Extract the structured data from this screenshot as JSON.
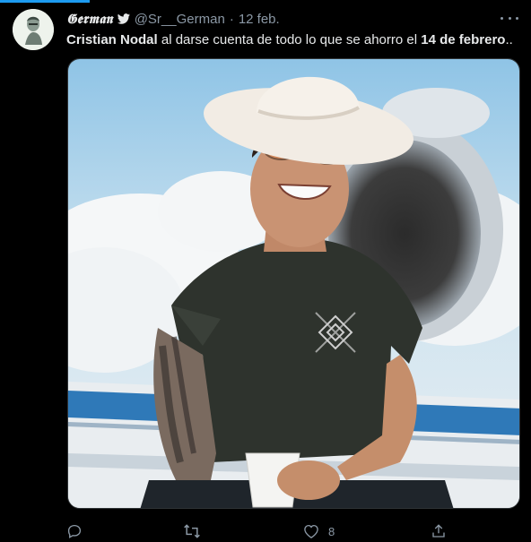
{
  "tweet": {
    "author_name": "𝕲𝖊𝖗𝖒𝖆𝖓",
    "handle": "@Sr__German",
    "separator": "·",
    "date": "12 feb.",
    "text": {
      "part1": "Cristian Nodal",
      "part2": " al darse cuenta de todo lo que se ahorro  el ",
      "part3": "14 de febrero",
      "part4": ".."
    },
    "actions": {
      "reply_count": "",
      "retweet_count": "",
      "like_count": "8",
      "share_count": ""
    }
  },
  "icons": {
    "avatar": "avatar-image",
    "verified_bird": "twitter-bird-icon",
    "more": "more-icon",
    "reply": "reply-icon",
    "retweet": "retweet-icon",
    "like": "heart-icon",
    "share": "share-icon"
  },
  "colors": {
    "background": "#000000",
    "accent": "#1d9bf0",
    "muted": "#8b98a5"
  }
}
